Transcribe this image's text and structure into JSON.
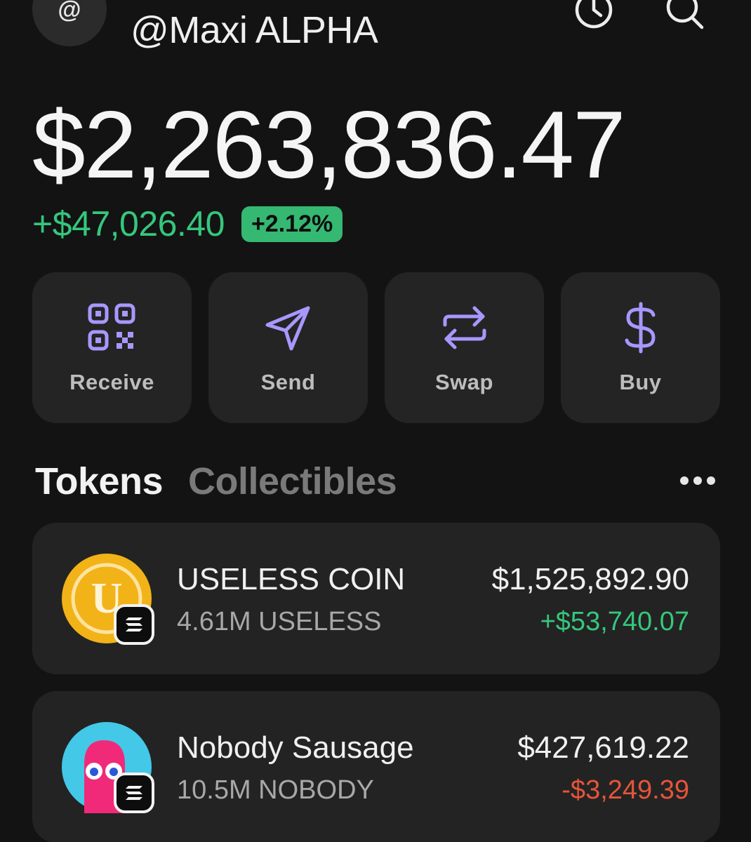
{
  "header": {
    "avatar_glyph": "@",
    "username": "@Maxi ALPHA",
    "icons": [
      "clock-icon",
      "search-icon"
    ]
  },
  "balance": {
    "total": "$2,263,836.47",
    "change_amount": "+$47,026.40",
    "change_percent": "+2.12%"
  },
  "actions": [
    {
      "label": "Receive",
      "icon": "qr-code-icon"
    },
    {
      "label": "Send",
      "icon": "send-icon"
    },
    {
      "label": "Swap",
      "icon": "swap-icon"
    },
    {
      "label": "Buy",
      "icon": "dollar-icon"
    }
  ],
  "tabs": [
    {
      "label": "Tokens",
      "active": true
    },
    {
      "label": "Collectibles",
      "active": false
    }
  ],
  "tokens": [
    {
      "name": "USELESS COIN",
      "amount": "4.61M USELESS",
      "value": "$1,525,892.90",
      "change": "+$53,740.07",
      "logo_glyph": "U",
      "chain_icon": "solana-icon"
    },
    {
      "name": "Nobody Sausage",
      "amount": "10.5M NOBODY",
      "value": "$427,619.22",
      "change": "-$3,249.39",
      "chain_icon": "solana-icon"
    }
  ],
  "colors": {
    "background": "#131313",
    "card": "#232323",
    "accent": "#a997ff",
    "positive": "#35c77c",
    "negative": "#e5553a"
  }
}
